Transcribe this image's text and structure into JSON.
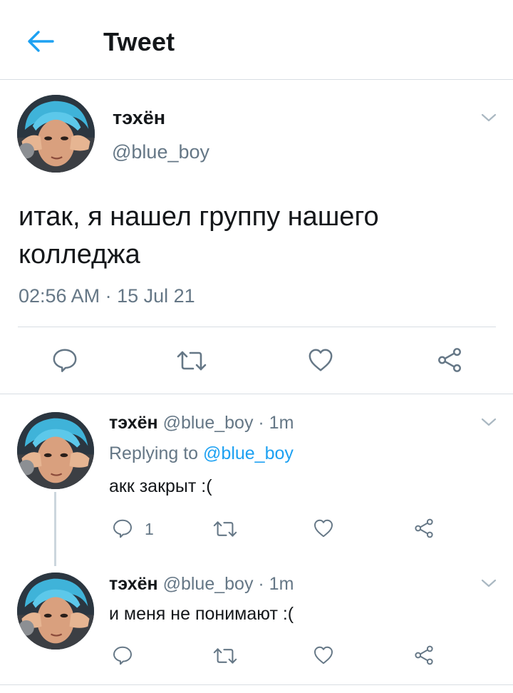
{
  "header": {
    "title": "Tweet"
  },
  "main_tweet": {
    "name": "тэхён",
    "handle": "@blue_boy",
    "text": "итак, я нашел группу нашего колледжа",
    "meta": "02:56 AM · 15 Jul 21"
  },
  "replies": [
    {
      "name": "тэхён",
      "handle_time": "@blue_boy · 1m",
      "replying_prefix": "Replying to",
      "replying_mention": "@blue_boy",
      "text": "акк закрыт :(",
      "reply_count": "1"
    },
    {
      "name": "тэхён",
      "handle_time": "@blue_boy · 1m",
      "text": "и меня не понимают :("
    }
  ],
  "icons": {
    "back": "back-arrow-icon",
    "reply": "reply-bubble-icon",
    "retweet": "retweet-icon",
    "like": "heart-icon",
    "share": "share-icon",
    "more": "chevron-down-icon"
  },
  "colors": {
    "accent": "#1da1f2",
    "icon": "#657786",
    "text": "#14171a",
    "divider": "#d8dde3"
  }
}
